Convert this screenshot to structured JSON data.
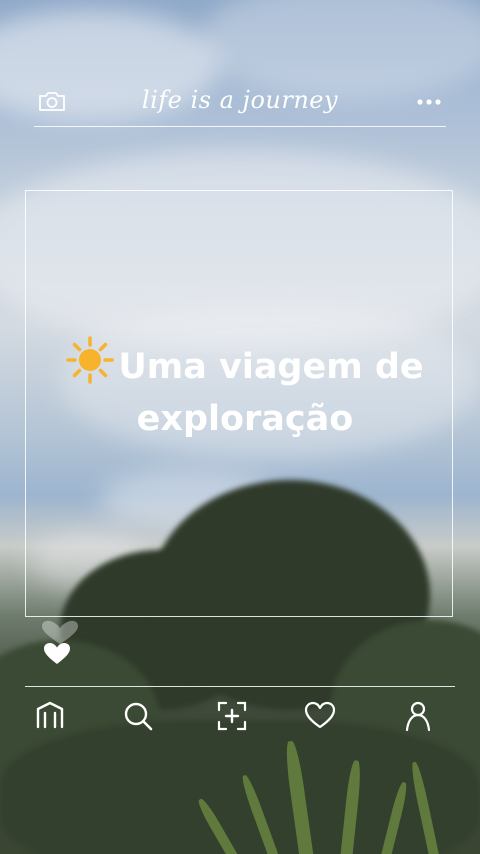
{
  "header": {
    "brand_text": "life is a journey",
    "left_icon": "camera-icon",
    "right_icon": "more-dots-icon"
  },
  "post": {
    "emoji": "sun-emoji",
    "headline_line1": "Uma viagem de",
    "headline_line2": "exploração"
  },
  "reactions": {
    "icons": [
      "heart-outline-icon",
      "heart-filled-icon"
    ]
  },
  "bottom_nav": {
    "items": [
      "home-icon",
      "search-icon",
      "add-post-icon",
      "heart-icon",
      "profile-icon"
    ]
  },
  "colors": {
    "foreground": "#ffffff",
    "sun": "#f7b32b"
  }
}
